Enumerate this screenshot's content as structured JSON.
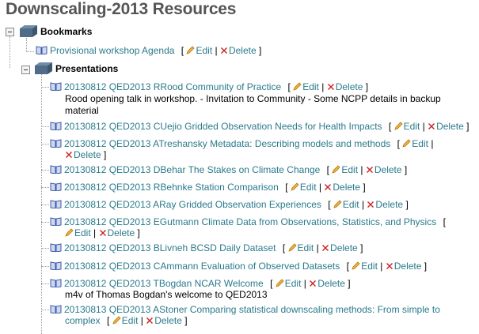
{
  "page": {
    "title": "Downscaling-2013 Resources"
  },
  "actions": {
    "edit": "Edit",
    "delete": "Delete",
    "open": "[",
    "close": "]",
    "sep": "|"
  },
  "folders": [
    {
      "label": "Bookmarks"
    },
    {
      "label": "Presentations"
    }
  ],
  "bookmarks": [
    {
      "title": "Provisional workshop Agenda"
    }
  ],
  "presentations": [
    {
      "title": "20130812 QED2013 RRood Community of Practice",
      "desc": [
        "Rood opening talk in workshop. - Invitation to Community - Some NCPP details in backup",
        "material"
      ]
    },
    {
      "title": "20130812 QED2013 CUejio Gridded Observation Needs for Health Impacts"
    },
    {
      "title": "20130812 QED2013 ATreshansky Metadata: Describing models and methods"
    },
    {
      "title": "20130812 QED2013 DBehar The Stakes on Climate Change"
    },
    {
      "title": "20130812 QED2013 RBehnke Station Comparison"
    },
    {
      "title": "20130812 QED2013 ARay Gridded Observation Experiences"
    },
    {
      "title": "20130812 QED2013 EGutmann Climate Data from Observations, Statistics, and Physics"
    },
    {
      "title": "20130812 QED2013 BLivneh BCSD Daily Dataset"
    },
    {
      "title": "20130812 QED2013 CAmmann Evaluation of Observed Datasets"
    },
    {
      "title": "20130812 QED2013 TBogdan NCAR Welcome",
      "desc": [
        "m4v of Thomas Bogdan's welcome to QED2013"
      ]
    },
    {
      "title": "20130813 QED2013 AStoner Comparing statistical downscaling methods: From simple to",
      "title2": "complex"
    }
  ],
  "colors": {
    "link": "#2a7a8c",
    "title": "#555555",
    "delete": "#cc2222",
    "folder": "#5b7a95"
  }
}
